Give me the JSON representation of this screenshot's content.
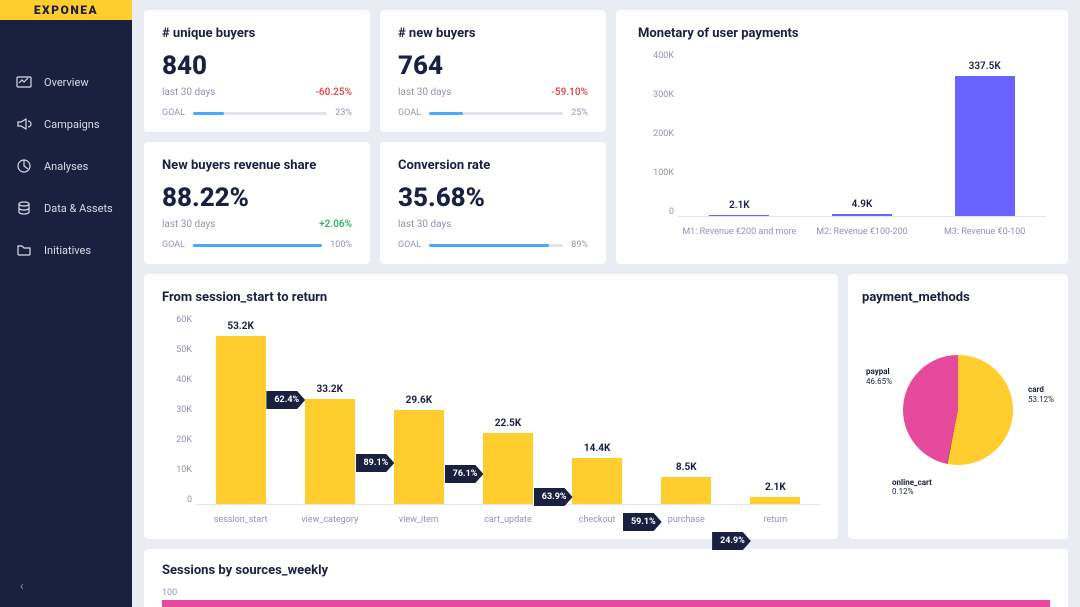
{
  "brand": "EXPONEA",
  "sidebar": {
    "items": [
      {
        "label": "Overview",
        "icon": "overview"
      },
      {
        "label": "Campaigns",
        "icon": "campaigns"
      },
      {
        "label": "Analyses",
        "icon": "analyses"
      },
      {
        "label": "Data & Assets",
        "icon": "data"
      },
      {
        "label": "Initiatives",
        "icon": "initiatives"
      }
    ]
  },
  "kpis": {
    "unique_buyers": {
      "title": "# unique buyers",
      "value": "840",
      "period": "last 30 days",
      "delta": "-60.25%",
      "goal_label": "GOAL",
      "goal_pct": "23%",
      "goal_width": 23
    },
    "new_buyers": {
      "title": "# new buyers",
      "value": "764",
      "period": "last 30 days",
      "delta": "-59.10%",
      "goal_label": "GOAL",
      "goal_pct": "25%",
      "goal_width": 25
    },
    "revenue_share": {
      "title": "New buyers revenue share",
      "value": "88.22%",
      "period": "last 30 days",
      "delta": "+2.06%",
      "goal_label": "GOAL",
      "goal_pct": "100%",
      "goal_width": 100
    },
    "conv_rate": {
      "title": "Conversion rate",
      "value": "35.68%",
      "period": "last 30 days",
      "delta": "",
      "goal_label": "GOAL",
      "goal_pct": "89%",
      "goal_width": 89
    }
  },
  "monetary": {
    "title": "Monetary of user payments"
  },
  "funnel": {
    "title": "From session_start to return"
  },
  "payment_methods": {
    "title": "payment_methods",
    "paypal": {
      "label": "paypal",
      "pct": "46.65%"
    },
    "card": {
      "label": "card",
      "pct": "53.12%"
    },
    "online_cart": {
      "label": "online_cart",
      "pct": "0.12%"
    }
  },
  "sessions": {
    "title": "Sessions by sources_weekly",
    "max_label": "100"
  },
  "chart_data": [
    {
      "id": "monetary",
      "type": "bar",
      "title": "Monetary of user payments",
      "categories": [
        "M1: Revenue €200 and more",
        "M2: Revenue €100-200",
        "M3: Revenue €0-100"
      ],
      "values": [
        2100,
        4900,
        337500
      ],
      "value_labels": [
        "2.1K",
        "4.9K",
        "337.5K"
      ],
      "ylabel": "",
      "ylim": [
        0,
        400000
      ],
      "yticks": [
        "400K",
        "300K",
        "200K",
        "100K",
        "0"
      ],
      "color": "#6b63ff"
    },
    {
      "id": "funnel",
      "type": "bar",
      "title": "From session_start to return",
      "categories": [
        "session_start",
        "view_category",
        "view_item",
        "cart_update",
        "checkout",
        "purchase",
        "return"
      ],
      "values": [
        53200,
        33200,
        29600,
        22500,
        14400,
        8500,
        2100
      ],
      "value_labels": [
        "53.2K",
        "33.2K",
        "29.6K",
        "22.5K",
        "14.4K",
        "8.5K",
        "2.1K"
      ],
      "step_pct": [
        "62.4%",
        "89.1%",
        "76.1%",
        "63.9%",
        "59.1%",
        "24.9%"
      ],
      "ylim": [
        0,
        60000
      ],
      "yticks": [
        "60K",
        "50K",
        "40K",
        "30K",
        "20K",
        "10K",
        "0"
      ],
      "color": "#ffce2e"
    },
    {
      "id": "payment_methods",
      "type": "pie",
      "title": "payment_methods",
      "series": [
        {
          "name": "card",
          "value": 53.12,
          "color": "#ffce2e"
        },
        {
          "name": "paypal",
          "value": 46.65,
          "color": "#e64a9c"
        },
        {
          "name": "online_cart",
          "value": 0.12,
          "color": "#4a4a4a"
        }
      ]
    }
  ]
}
